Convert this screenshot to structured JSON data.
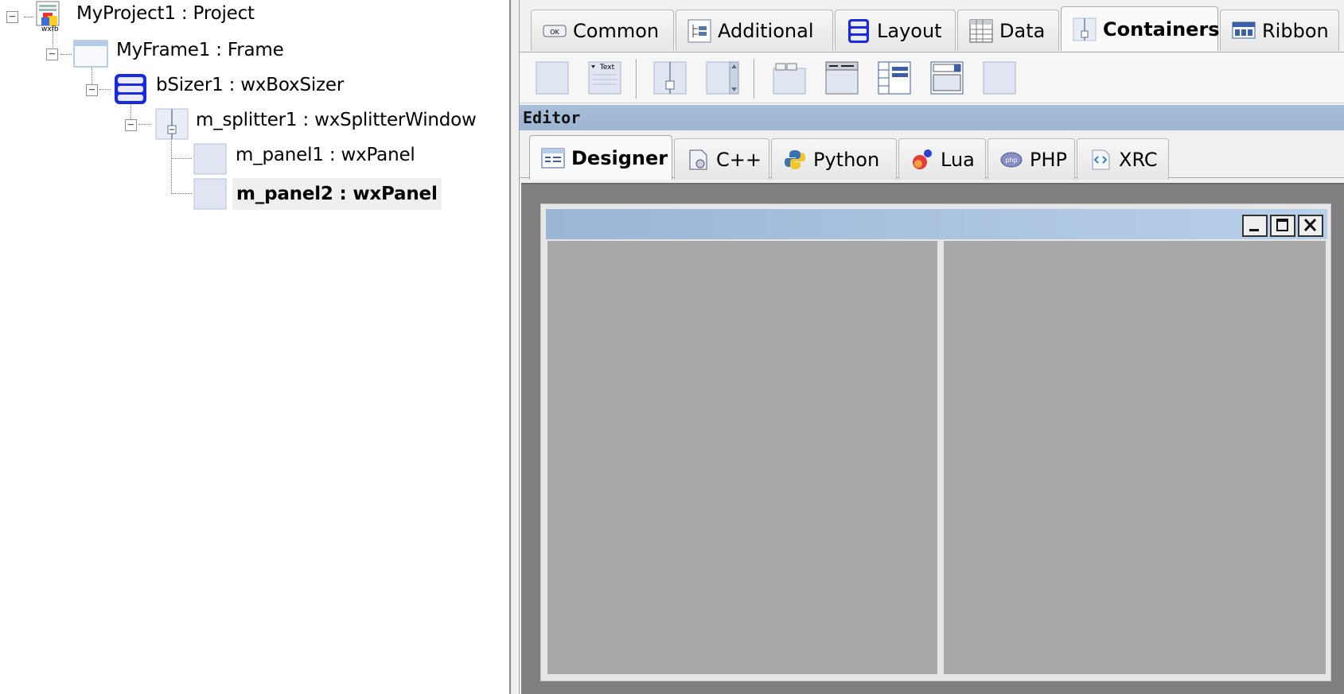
{
  "tree": {
    "nodes": [
      {
        "label": "MyProject1 : Project",
        "icon": "wxfb-project-icon",
        "icon_caption": "wxfb"
      },
      {
        "label": "MyFrame1 : Frame",
        "icon": "frame-icon"
      },
      {
        "label": "bSizer1 : wxBoxSizer",
        "icon": "box-sizer-icon"
      },
      {
        "label": "m_splitter1 : wxSplitterWindow",
        "icon": "splitter-icon"
      },
      {
        "label": "m_panel1 : wxPanel",
        "icon": "panel-icon"
      },
      {
        "label": "m_panel2 : wxPanel",
        "icon": "panel-icon",
        "selected": true
      }
    ]
  },
  "palette": {
    "tabs": [
      "Common",
      "Additional",
      "Layout",
      "Data",
      "Containers",
      "Ribbon"
    ],
    "active_tab": "Containers",
    "tools": [
      "panel-tool-icon",
      "collapsible-pane-tool-icon",
      "splitter-window-tool-icon",
      "scrolled-window-tool-icon",
      "notebook-tool-icon",
      "auinotebook-tool-icon",
      "listbook-tool-icon",
      "choicebook-tool-icon",
      "simplebook-tool-icon"
    ],
    "text_tool_label": "Text",
    "ok_label": "OK"
  },
  "editor": {
    "caption": "Editor",
    "tabs": [
      "Designer",
      "C++",
      "Python",
      "Lua",
      "PHP",
      "XRC"
    ],
    "active_tab": "Designer",
    "php_badge": "php"
  },
  "colors": {
    "caption_bar": "#9cb5d1",
    "canvas": "#7f7f7f",
    "pane": "#a9a9a9"
  }
}
